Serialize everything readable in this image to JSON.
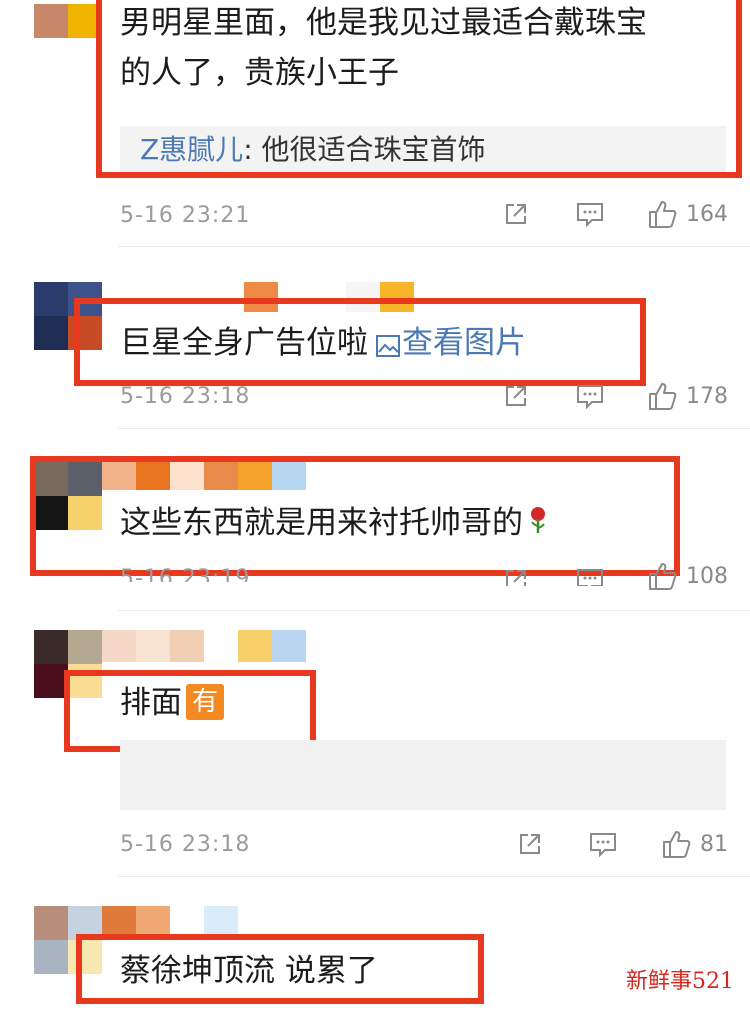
{
  "comments": [
    {
      "text_line1": "男明星里面，他是我见过最适合戴珠宝",
      "text_line2": "的人了，贵族小王子",
      "quote_user": "Z惠腻儿",
      "quote_text": ": 他很适合珠宝首饰",
      "time": "5-16 23:21",
      "likes": "164"
    },
    {
      "text": "巨星全身广告位啦",
      "view_image": "查看图片",
      "time": "5-16 23:18",
      "likes": "178"
    },
    {
      "text": "这些东西就是用来衬托帅哥的",
      "time": "5-16 23:19",
      "likes": "108"
    },
    {
      "text": "排面",
      "badge": "有",
      "time": "5-16 23:18",
      "likes": "81"
    },
    {
      "text": "蔡徐坤顶流 说累了"
    }
  ],
  "watermark": "新鲜事521",
  "colors": {
    "highlight_box": "#e8391f",
    "link_blue": "#4a79b4",
    "badge_orange": "#f58a22"
  },
  "icons": [
    "share-icon",
    "comment-icon",
    "like-icon",
    "image-icon",
    "rose-icon"
  ]
}
